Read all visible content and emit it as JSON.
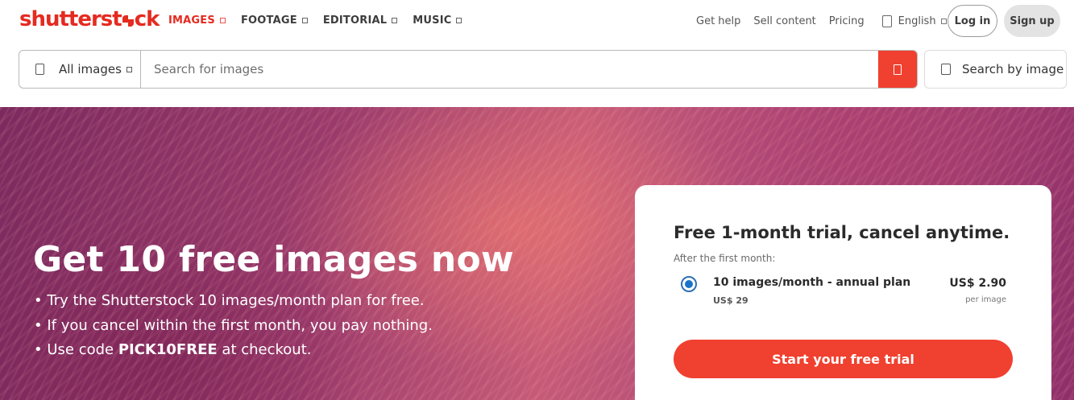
{
  "header": {
    "logo_pre": "shutterst",
    "logo_post": "ck",
    "nav": [
      {
        "label": "IMAGES",
        "active": true
      },
      {
        "label": "FOOTAGE",
        "active": false
      },
      {
        "label": "EDITORIAL",
        "active": false
      },
      {
        "label": "MUSIC",
        "active": false
      }
    ],
    "get_help": "Get help",
    "sell_content": "Sell content",
    "pricing": "Pricing",
    "language": "English",
    "login": "Log in",
    "signup": "Sign up"
  },
  "search": {
    "asset_type": "All images",
    "placeholder": "Search for images",
    "search_by_image": "Search by image"
  },
  "hero": {
    "title": "Get 10 free images now",
    "bullet_1": "• Try the Shutterstock 10 images/month plan for free.",
    "bullet_2": "• If you cancel within the first month, you pay nothing.",
    "bullet_3_pre": "• Use code ",
    "bullet_3_code": "PICK10FREE",
    "bullet_3_post": " at checkout."
  },
  "trial_card": {
    "title": "Free 1-month trial, cancel anytime.",
    "subtitle": "After the first month:",
    "plan_name": "10 images/month - annual plan",
    "plan_total": "US$ 29",
    "price": "US$ 2.90",
    "price_unit": "per image",
    "cta": "Start your free trial"
  },
  "colors": {
    "brand_red": "#e52a20",
    "cta_red": "#f0402f",
    "radio_blue": "#1a73c9"
  },
  "icons": [
    "image-icon",
    "caret-down-icon",
    "search-icon",
    "camera-icon",
    "globe-icon"
  ]
}
